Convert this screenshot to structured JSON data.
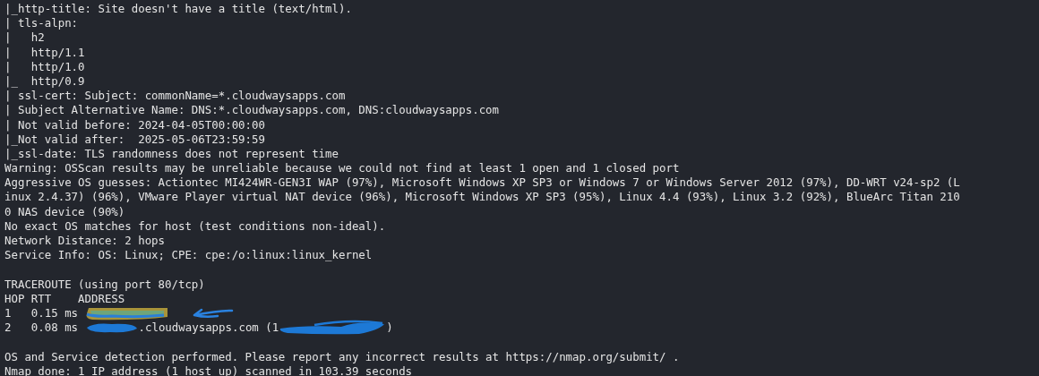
{
  "terminal": {
    "lines": [
      {
        "kind": "text",
        "text": "|_http-title: Site doesn't have a title (text/html)."
      },
      {
        "kind": "text",
        "text": "| tls-alpn: "
      },
      {
        "kind": "text",
        "text": "|   h2"
      },
      {
        "kind": "text",
        "text": "|   http/1.1"
      },
      {
        "kind": "text",
        "text": "|   http/1.0"
      },
      {
        "kind": "text",
        "text": "|_  http/0.9"
      },
      {
        "kind": "text",
        "text": "| ssl-cert: Subject: commonName=*.cloudwaysapps.com"
      },
      {
        "kind": "text",
        "text": "| Subject Alternative Name: DNS:*.cloudwaysapps.com, DNS:cloudwaysapps.com"
      },
      {
        "kind": "text",
        "text": "| Not valid before: 2024-04-05T00:00:00"
      },
      {
        "kind": "text",
        "text": "|_Not valid after:  2025-05-06T23:59:59"
      },
      {
        "kind": "text",
        "text": "|_ssl-date: TLS randomness does not represent time"
      },
      {
        "kind": "text",
        "text": "Warning: OSScan results may be unreliable because we could not find at least 1 open and 1 closed port"
      },
      {
        "kind": "text",
        "text": "Aggressive OS guesses: Actiontec MI424WR-GEN3I WAP (97%), Microsoft Windows XP SP3 or Windows 7 or Windows Server 2012 (97%), DD-WRT v24-sp2 (L"
      },
      {
        "kind": "text",
        "text": "inux 2.4.37) (96%), VMware Player virtual NAT device (96%), Microsoft Windows XP SP3 (95%), Linux 4.4 (93%), Linux 3.2 (92%), BlueArc Titan 210"
      },
      {
        "kind": "text",
        "text": "0 NAS device (90%)"
      },
      {
        "kind": "text",
        "text": "No exact OS matches for host (test conditions non-ideal)."
      },
      {
        "kind": "text",
        "text": "Network Distance: 2 hops"
      },
      {
        "kind": "text",
        "text": "Service Info: OS: Linux; CPE: cpe:/o:linux:linux_kernel"
      },
      {
        "kind": "blank"
      },
      {
        "kind": "text",
        "text": "TRACEROUTE (using port 80/tcp)"
      },
      {
        "kind": "text",
        "text": "HOP RTT    ADDRESS"
      },
      {
        "kind": "hop",
        "segments": [
          {
            "kind": "text",
            "text": "1   0.15 ms "
          },
          {
            "kind": "highlight"
          },
          {
            "kind": "arrow"
          }
        ]
      },
      {
        "kind": "hop",
        "segments": [
          {
            "kind": "text",
            "text": "2   0.08 ms "
          },
          {
            "kind": "scribble"
          },
          {
            "kind": "text",
            "text": ".cloudwaysapps.com (1"
          },
          {
            "kind": "scribble-wide"
          },
          {
            "kind": "text",
            "text": ")"
          }
        ]
      },
      {
        "kind": "blank"
      },
      {
        "kind": "text",
        "text": "OS and Service detection performed. Please report any incorrect results at https://nmap.org/submit/ ."
      },
      {
        "kind": "text",
        "text": "Nmap done: 1 IP address (1 host up) scanned in 103.39 seconds"
      }
    ]
  }
}
